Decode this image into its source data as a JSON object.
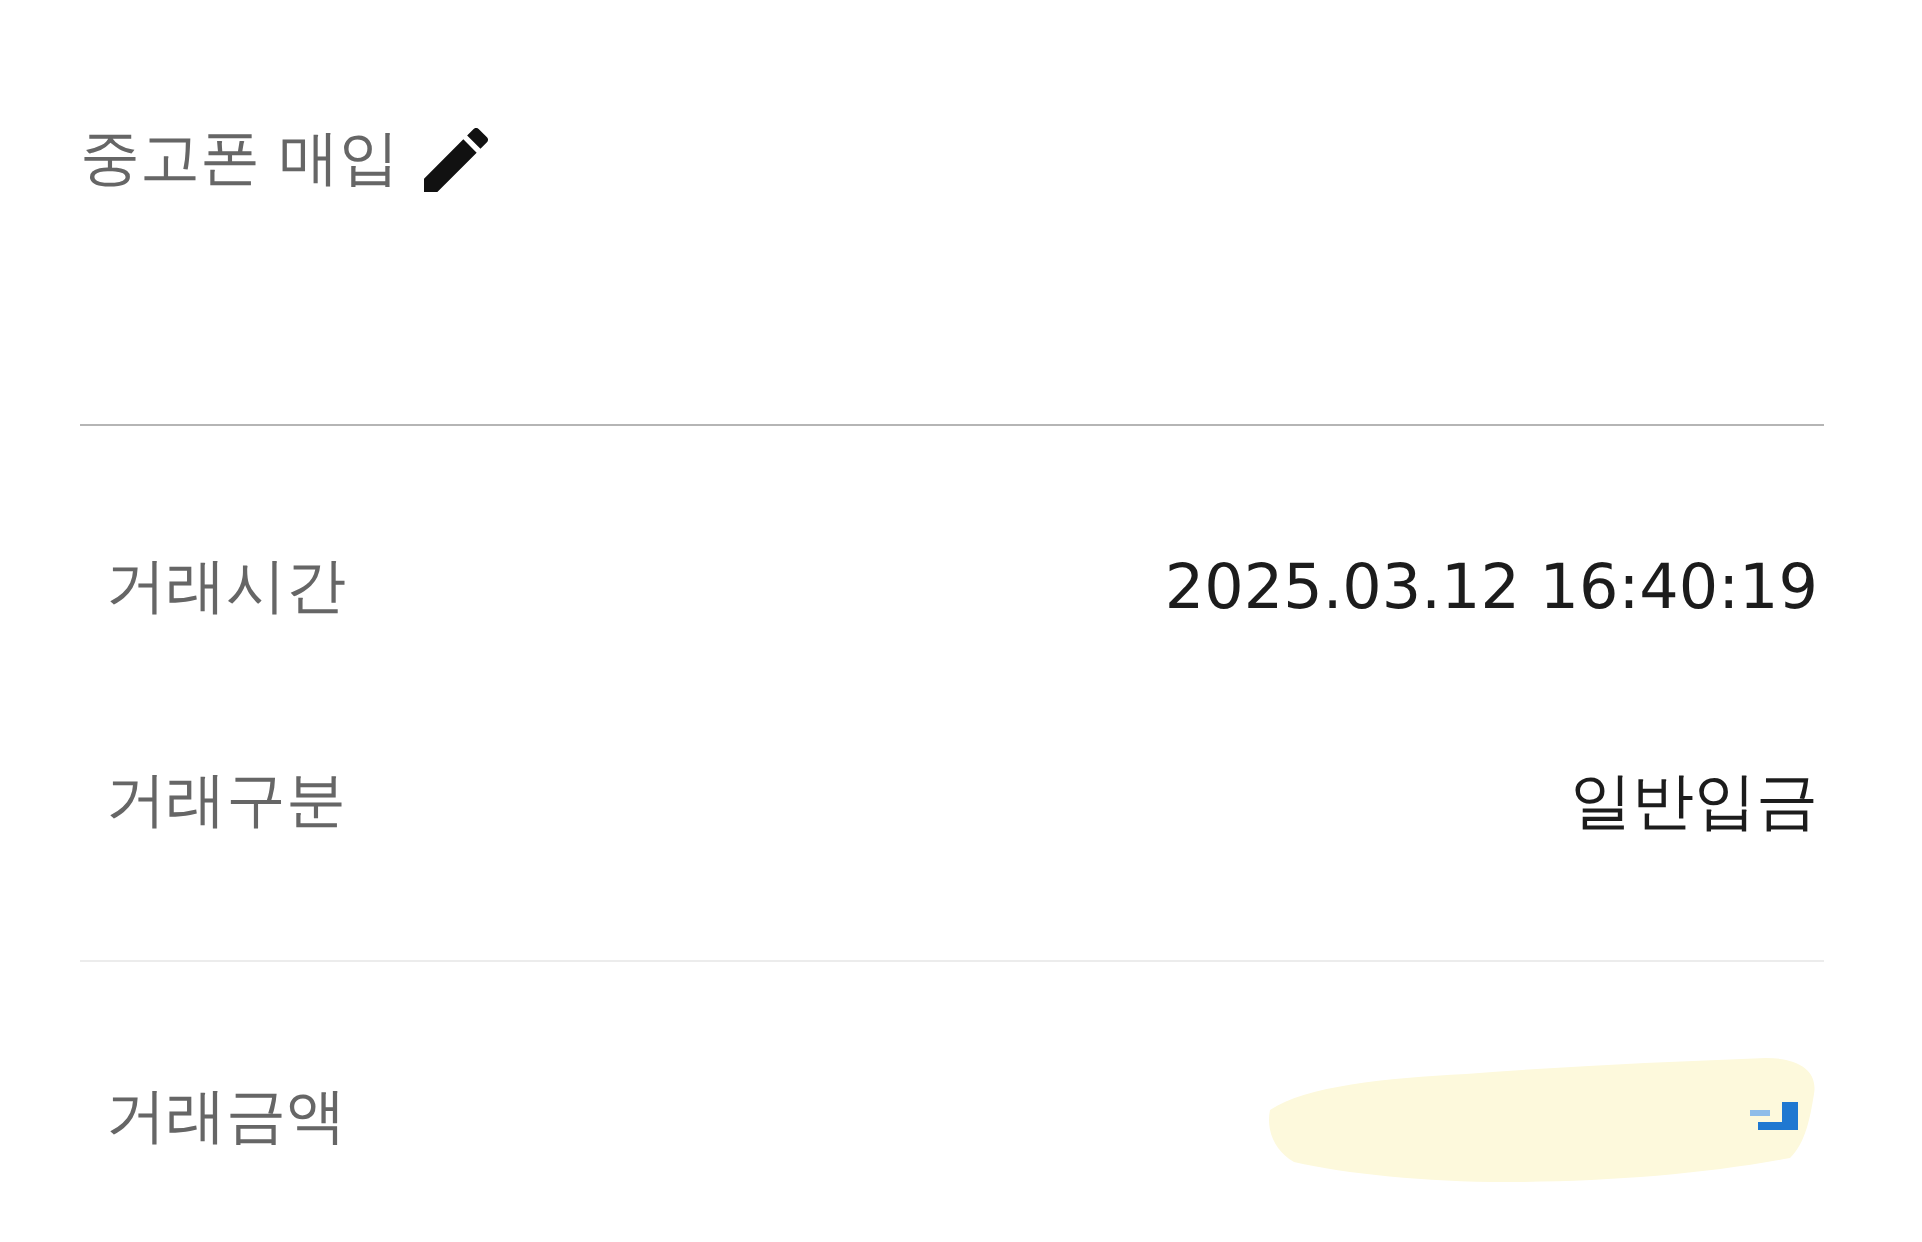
{
  "header": {
    "title": "중고폰 매입"
  },
  "sections": [
    {
      "rows": [
        {
          "label": "거래시간",
          "kind": "text",
          "value": "2025.03.12 16:40:19"
        },
        {
          "label": "거래구분",
          "kind": "text",
          "value": "일반입금"
        }
      ]
    },
    {
      "rows": [
        {
          "label": "거래금액",
          "kind": "redacted"
        }
      ]
    }
  ]
}
